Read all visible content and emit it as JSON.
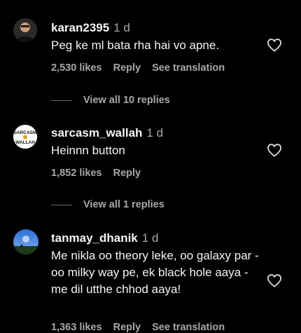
{
  "comments": [
    {
      "username": "karan2395",
      "time": "1 d",
      "text": "Peg ke ml bata rha hai vo apne.",
      "likes": "2,530 likes",
      "reply": "Reply",
      "see_translation": "See translation",
      "view_replies": "View all 10 replies"
    },
    {
      "username": "sarcasm_wallah",
      "time": "1 d",
      "text": "Heinnn button",
      "likes": "1,852 likes",
      "reply": "Reply",
      "view_replies": "View all 1 replies",
      "avatar_text": [
        "SARCASM",
        "WALLAH"
      ]
    },
    {
      "username": "tanmay_dhanik",
      "time": "1 d",
      "text": "Me nikla oo theory leke, oo galaxy par - oo milky way pe, ek black hole aaya - me dil utthe chhod aaya!",
      "likes": "1,363 likes",
      "reply": "Reply",
      "see_translation": "See translation"
    }
  ],
  "colors": {
    "background": "#000000",
    "primary_text": "#f5f5f5",
    "secondary_text": "#a8a8a8"
  },
  "icons": [
    "heart-outline-icon"
  ]
}
